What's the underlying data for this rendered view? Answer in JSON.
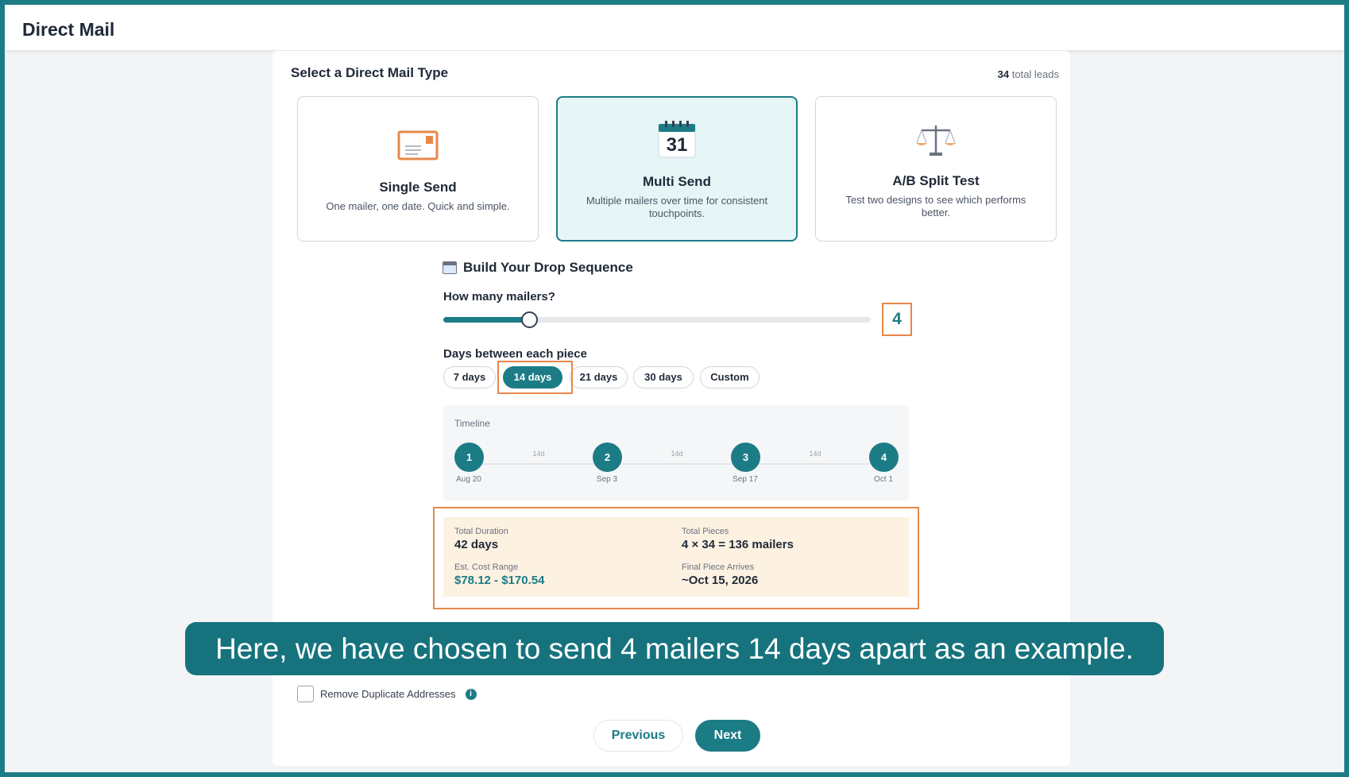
{
  "header": {
    "title": "Direct Mail"
  },
  "type_section": {
    "title": "Select a Direct Mail Type",
    "leads_count": "34",
    "leads_label": "total leads",
    "cards": [
      {
        "title": "Single Send",
        "description": "One mailer, one date. Quick and simple.",
        "icon": "envelope-icon",
        "selected": false
      },
      {
        "title": "Multi Send",
        "description": "Multiple mailers over time for consistent touchpoints.",
        "icon": "calendar-icon",
        "calendar_number": "31",
        "selected": true
      },
      {
        "title": "A/B Split Test",
        "description": "Test two designs to see which performs better.",
        "icon": "scale-icon",
        "selected": false
      }
    ]
  },
  "sequence": {
    "title": "Build Your Drop Sequence",
    "mailers_label": "How many mailers?",
    "mailers_value": "4",
    "slider_fraction": 0.2,
    "days_label": "Days between each piece",
    "day_options": [
      "7 days",
      "14 days",
      "21 days",
      "30 days",
      "Custom"
    ],
    "selected_day_option": "14 days"
  },
  "timeline": {
    "label": "Timeline",
    "nodes": [
      {
        "number": "1",
        "date": "Aug 20"
      },
      {
        "number": "2",
        "date": "Sep 3"
      },
      {
        "number": "3",
        "date": "Sep 17"
      },
      {
        "number": "4",
        "date": "Oct 1"
      }
    ],
    "gap_label": "14d"
  },
  "summary": {
    "total_duration_label": "Total Duration",
    "total_duration_value": "42 days",
    "total_pieces_label": "Total Pieces",
    "total_pieces_value": "4 × 34 = 136 mailers",
    "cost_label": "Est. Cost Range",
    "cost_value": "$78.12 - $170.54",
    "final_label": "Final Piece Arrives",
    "final_value": "~Oct 15, 2026"
  },
  "options": {
    "remove_duplicates_label": "Remove Duplicate Addresses",
    "remove_duplicates_checked": false
  },
  "buttons": {
    "previous": "Previous",
    "next": "Next"
  },
  "caption": "Here, we have chosen to send 4 mailers 14 days apart as an example.",
  "colors": {
    "brand": "#1c7c86",
    "highlight": "#e8874a",
    "summary_bg": "#fdf1e1"
  }
}
